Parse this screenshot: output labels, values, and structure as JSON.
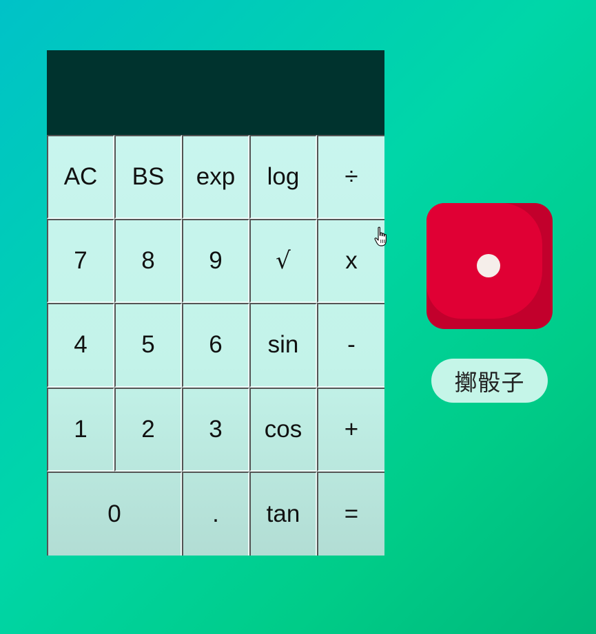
{
  "calculator": {
    "display": "",
    "keys": [
      {
        "label": "AC"
      },
      {
        "label": "BS"
      },
      {
        "label": "exp"
      },
      {
        "label": "log"
      },
      {
        "label": "÷"
      },
      {
        "label": "7"
      },
      {
        "label": "8"
      },
      {
        "label": "9"
      },
      {
        "label": "√"
      },
      {
        "label": "x"
      },
      {
        "label": "4"
      },
      {
        "label": "5"
      },
      {
        "label": "6"
      },
      {
        "label": "sin"
      },
      {
        "label": "-"
      },
      {
        "label": "1"
      },
      {
        "label": "2"
      },
      {
        "label": "3"
      },
      {
        "label": "cos"
      },
      {
        "label": "+"
      },
      {
        "label": "0"
      },
      {
        "label": "."
      },
      {
        "label": "tan"
      },
      {
        "label": "="
      }
    ]
  },
  "dice": {
    "value": 1,
    "color": "#e00034",
    "shadow_color": "#c2002c",
    "pip_color": "#f5eeea",
    "roll_label": "擲骰子"
  },
  "cursor": {
    "icon": "hand-pointer-icon"
  },
  "colors": {
    "background_start": "#00c2c8",
    "background_end": "#00cc88",
    "display_bg": "#00332e",
    "keypad_bg": "#c3f3e9"
  }
}
